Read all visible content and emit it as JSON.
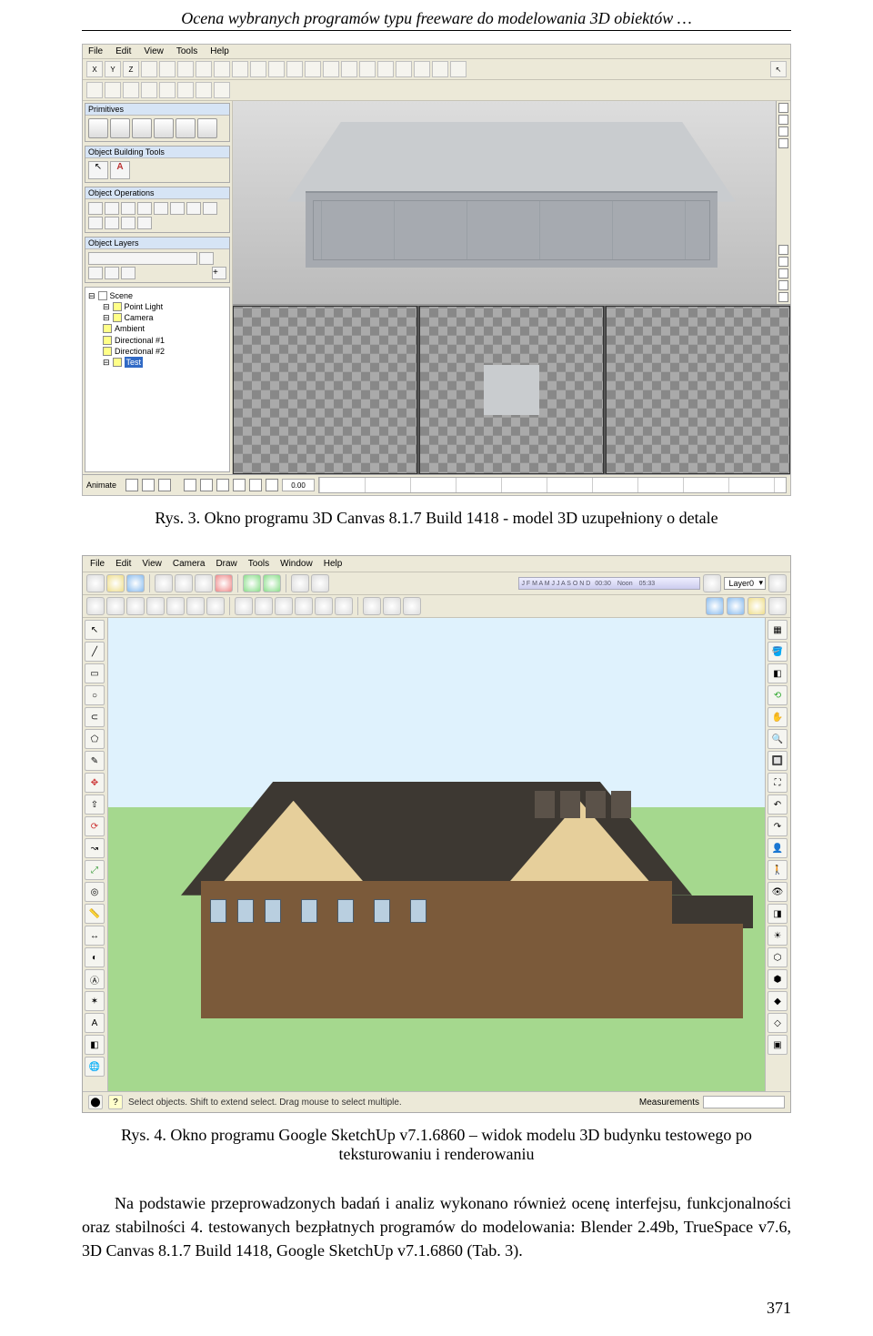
{
  "header": {
    "running_title": "Ocena wybranych programów typu freeware do modelowania 3D obiektów …"
  },
  "canvas3d": {
    "menus": [
      "File",
      "Edit",
      "View",
      "Tools",
      "Help"
    ],
    "axis_btns": [
      "X",
      "Y",
      "Z"
    ],
    "panels": {
      "primitives": "Primitives",
      "obj_build": "Object Building Tools",
      "obj_ops": "Object Operations",
      "obj_layers": "Object Layers"
    },
    "obj_build_labels": {
      "arrow": "↖",
      "a": "A"
    },
    "scene_tree": {
      "root": "Scene",
      "items": [
        "Point Light",
        "Camera",
        "Ambient",
        "Directional #1",
        "Directional #2",
        "Test"
      ],
      "selected": "Test"
    },
    "animate_label": "Animate",
    "frame_value": "0.00"
  },
  "caption1": "Rys. 3. Okno programu 3D Canvas 8.1.7 Build 1418 - model 3D uzupełniony o detale",
  "sketchup": {
    "menus": [
      "File",
      "Edit",
      "View",
      "Camera",
      "Draw",
      "Tools",
      "Window",
      "Help"
    ],
    "time_labels": "J F M A M J J A S O N D",
    "time_noon_label": "Noon",
    "time_val_1": "00:30",
    "time_val_2": "05:33",
    "layer_label": "Layer0",
    "status_hint": "Select objects. Shift to extend select. Drag mouse to select multiple.",
    "measurements_label": "Measurements",
    "help_icon": "?"
  },
  "caption2": "Rys. 4. Okno programu Google SketchUp v7.1.6860 – widok modelu 3D budynku testowego po teksturowaniu i renderowaniu",
  "body_text": "Na podstawie przeprowadzonych badań i analiz wykonano również ocenę interfejsu, funkcjonalności oraz stabilności 4. testowanych bezpłatnych programów do modelowania: Blender 2.49b, TrueSpace v7.6, 3D Canvas 8.1.7 Build 1418, Google SketchUp v7.1.6860 (Tab. 3).",
  "page_number": "371"
}
